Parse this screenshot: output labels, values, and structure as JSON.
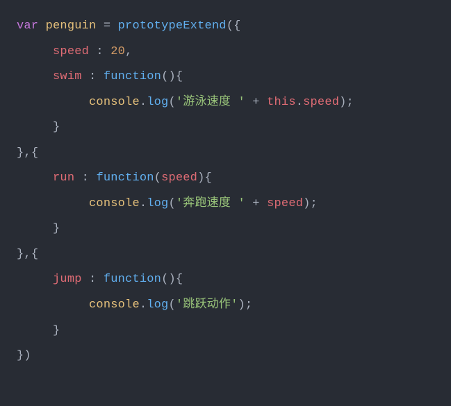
{
  "code": {
    "kw_var": "var",
    "varName": "penguin",
    "eq": " = ",
    "fnCall": "prototypeExtend",
    "open": "({",
    "close": "})",
    "obj1": {
      "speedKey": "speed",
      "speedSep": " : ",
      "speedVal": "20",
      "comma": ",",
      "swimKey": "swim",
      "swimSep": " : ",
      "fnKw": "function",
      "fnArgs0": "()",
      "braceOpen": "{",
      "consoleObj": "console",
      "dot": ".",
      "logFn": "log",
      "logOpen": "(",
      "swimStr": "'游泳速度 '",
      "plus": " + ",
      "thisKw": "this",
      "thisDot": ".",
      "thisProp": "speed",
      "logCloseSemi": ");",
      "braceClose": "}"
    },
    "sepComma": ",",
    "sepBrace": "{",
    "obj2": {
      "runKey": "run",
      "runSep": " : ",
      "fnKw": "function",
      "fnArgsOpen": "(",
      "param": "speed",
      "fnArgsClose": ")",
      "braceOpen": "{",
      "consoleObj": "console",
      "dot": ".",
      "logFn": "log",
      "logOpen": "(",
      "runStr": "'奔跑速度 '",
      "plus": " + ",
      "paramRef": "speed",
      "logCloseSemi": ");",
      "braceClose": "}"
    },
    "obj3": {
      "jumpKey": "jump",
      "jumpSep": " : ",
      "fnKw": "function",
      "fnArgs0": "()",
      "braceOpen": "{",
      "consoleObj": "console",
      "dot": ".",
      "logFn": "log",
      "logOpen": "(",
      "jumpStr": "'跳跃动作'",
      "logCloseSemi": ");",
      "braceClose": "}"
    }
  }
}
